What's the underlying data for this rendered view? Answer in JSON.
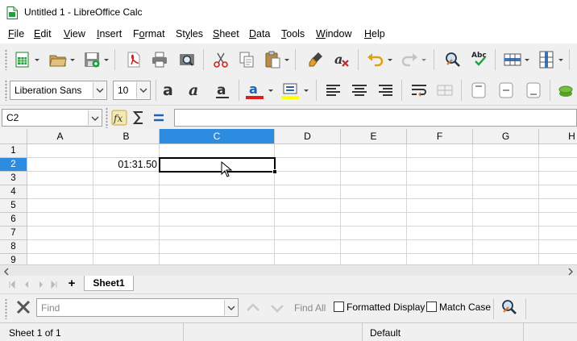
{
  "window": {
    "title": "Untitled 1 - LibreOffice Calc"
  },
  "menubar": {
    "items": [
      {
        "label": "File",
        "key": "F"
      },
      {
        "label": "Edit",
        "key": "E"
      },
      {
        "label": "View",
        "key": "V"
      },
      {
        "label": "Insert",
        "key": "I"
      },
      {
        "label": "Format",
        "key": "o"
      },
      {
        "label": "Styles",
        "key": "y"
      },
      {
        "label": "Sheet",
        "key": "S"
      },
      {
        "label": "Data",
        "key": "D"
      },
      {
        "label": "Tools",
        "key": "T"
      },
      {
        "label": "Window",
        "key": "W"
      },
      {
        "label": "Help",
        "key": "H"
      }
    ]
  },
  "formatting": {
    "font_name": "Liberation Sans",
    "font_size": "10",
    "font_color": "#e01b1b",
    "highlight_color": "#ffff00"
  },
  "formula_bar": {
    "name_box": "C2",
    "input": ""
  },
  "sheet": {
    "columns": [
      "A",
      "B",
      "C",
      "D",
      "E",
      "F",
      "G",
      "H"
    ],
    "selected_column": "C",
    "rows": [
      "1",
      "2",
      "3",
      "4",
      "5",
      "6",
      "7",
      "8",
      "9"
    ],
    "selected_row": "2",
    "cells": {
      "B2": "01:31.50"
    },
    "active_cell": "C2",
    "selection_color": "#2e8ce0"
  },
  "tabs": {
    "add_label": "+",
    "sheets": [
      "Sheet1"
    ]
  },
  "find_toolbar": {
    "placeholder": "Find",
    "find_all": "Find All",
    "formatted_display": "Formatted Display",
    "match_case": "Match Case"
  },
  "status": {
    "sheet_position": "Sheet 1 of 1",
    "page_style": "Default"
  }
}
